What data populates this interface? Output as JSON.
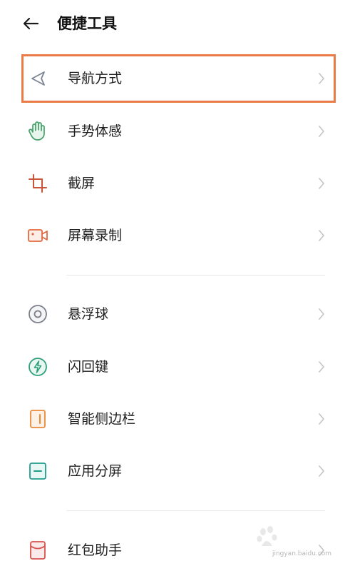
{
  "header": {
    "title": "便捷工具"
  },
  "groups": [
    {
      "items": [
        {
          "label": "导航方式",
          "icon": "navigation-arrow-icon",
          "color": "#7b8494"
        },
        {
          "label": "手势体感",
          "icon": "hand-gesture-icon",
          "color": "#46a06a"
        },
        {
          "label": "截屏",
          "icon": "crop-screenshot-icon",
          "color": "#c9563a"
        },
        {
          "label": "屏幕录制",
          "icon": "video-record-icon",
          "color": "#e2693f"
        }
      ]
    },
    {
      "items": [
        {
          "label": "悬浮球",
          "icon": "floating-ball-icon",
          "color": "#7a8089"
        },
        {
          "label": "闪回键",
          "icon": "flashback-bolt-icon",
          "color": "#2f9e7a"
        },
        {
          "label": "智能侧边栏",
          "icon": "smart-sidebar-icon",
          "color": "#e98a3a"
        },
        {
          "label": "应用分屏",
          "icon": "split-screen-icon",
          "color": "#1f9c8c"
        }
      ]
    },
    {
      "items": [
        {
          "label": "红包助手",
          "icon": "red-envelope-icon",
          "color": "#d9534f"
        }
      ]
    }
  ],
  "highlight_color": "#ea7a46",
  "watermark": {
    "text": "jingyan.baidu.com"
  }
}
